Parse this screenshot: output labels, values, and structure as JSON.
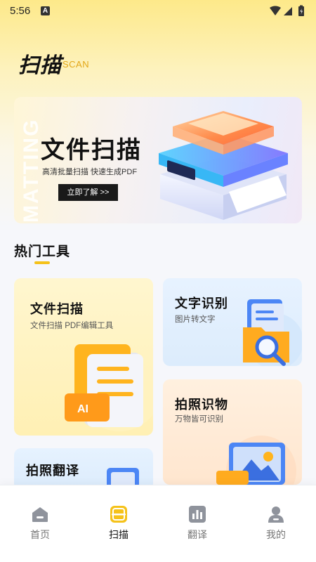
{
  "status_bar": {
    "time": "5:56",
    "notification_badge": "A"
  },
  "header": {
    "title": "扫描",
    "subtitle": "SCAN"
  },
  "banner": {
    "watermark": "MATTING",
    "title": "文件扫描",
    "subtitle": "高清批量扫描 快速生成PDF",
    "button_label": "立即了解 >>"
  },
  "section": {
    "title": "热门工具"
  },
  "cards": {
    "file_scan": {
      "title": "文件扫描",
      "desc": "文件扫描 PDF编辑工具",
      "badge": "AI"
    },
    "text_recognition": {
      "title": "文字识别",
      "desc": "图片转文字"
    },
    "photo_recognition": {
      "title": "拍照识物",
      "desc": "万物皆可识别"
    },
    "photo_translate": {
      "title": "拍照翻译"
    }
  },
  "bottom_nav": {
    "items": [
      {
        "label": "首页",
        "icon": "home-icon"
      },
      {
        "label": "扫描",
        "icon": "scan-icon",
        "active": true
      },
      {
        "label": "翻译",
        "icon": "translate-icon"
      },
      {
        "label": "我的",
        "icon": "profile-icon"
      }
    ]
  },
  "colors": {
    "accent": "#f5c21a",
    "subtitle": "#e3a717",
    "ocr_card": "#e3f0fd",
    "scan_card": "#fff3c4",
    "photo_card": "#ffead6"
  }
}
